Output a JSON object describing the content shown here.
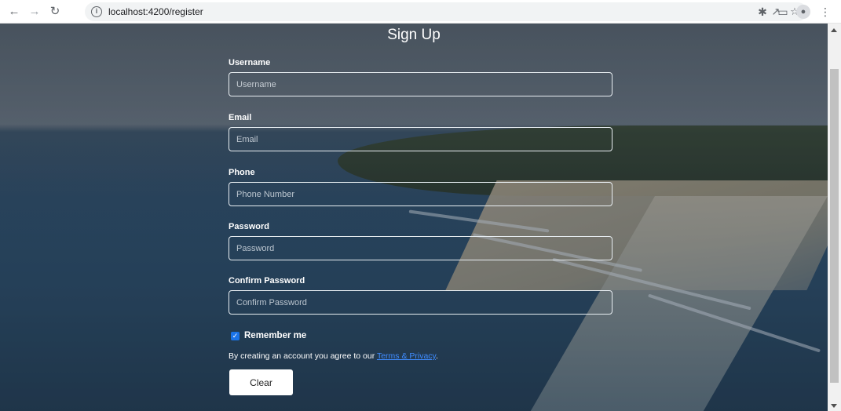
{
  "browser": {
    "url": "localhost:4200/register",
    "icons": [
      "back-icon",
      "forward-icon",
      "reload-icon",
      "info-icon",
      "share-icon",
      "star-icon",
      "extensions-icon",
      "side-panel-icon",
      "profile-icon",
      "menu-icon"
    ]
  },
  "form": {
    "title": "Sign Up",
    "fields": [
      {
        "label": "Username",
        "placeholder": "Username"
      },
      {
        "label": "Email",
        "placeholder": "Email"
      },
      {
        "label": "Phone",
        "placeholder": "Phone Number"
      },
      {
        "label": "Password",
        "placeholder": "Password"
      },
      {
        "label": "Confirm Password",
        "placeholder": "Confirm Password"
      }
    ],
    "remember_label": "Remember me",
    "remember_checked": true,
    "terms_prefix": "By creating an account you agree to our ",
    "terms_link": "Terms & Privacy",
    "terms_suffix": ".",
    "clear_label": "Clear"
  },
  "colors": {
    "link": "#3f8cff",
    "checkbox": "#1a73e8"
  }
}
